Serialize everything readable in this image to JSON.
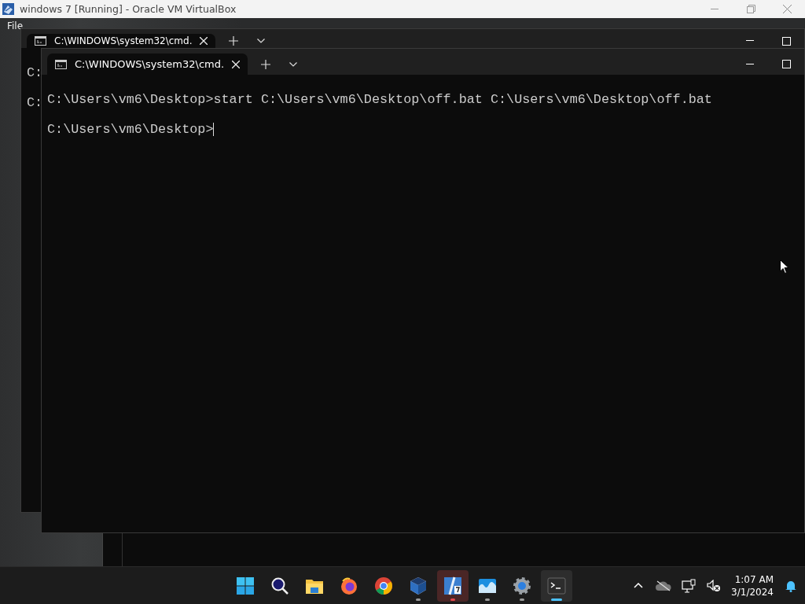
{
  "host_window": {
    "title": "windows 7 [Running] - Oracle VM VirtualBox"
  },
  "vm_menu": [
    "File"
  ],
  "back_terminal": {
    "tab_title": "C:\\WINDOWS\\system32\\cmd.",
    "lines": [
      "C:",
      "C:"
    ]
  },
  "front_terminal": {
    "tab_title": "C:\\WINDOWS\\system32\\cmd.",
    "lines": [
      "C:\\Users\\vm6\\Desktop>start C:\\Users\\vm6\\Desktop\\off.bat C:\\Users\\vm6\\Desktop\\off.bat",
      "C:\\Users\\vm6\\Desktop>"
    ]
  },
  "taskbar": {
    "apps": [
      {
        "running": false,
        "selected": false,
        "attention": false
      },
      {
        "running": false,
        "selected": false,
        "attention": false
      },
      {
        "running": false,
        "selected": false,
        "attention": false
      },
      {
        "running": false,
        "selected": false,
        "attention": false
      },
      {
        "running": false,
        "selected": false,
        "attention": false
      },
      {
        "running": true,
        "selected": false,
        "attention": false
      },
      {
        "running": true,
        "selected": false,
        "attention": true
      },
      {
        "running": true,
        "selected": false,
        "attention": false
      },
      {
        "running": true,
        "selected": false,
        "attention": false
      },
      {
        "running": true,
        "selected": true,
        "attention": false
      }
    ],
    "tray": {
      "time": "1:07 AM",
      "date": "3/1/2024"
    }
  }
}
